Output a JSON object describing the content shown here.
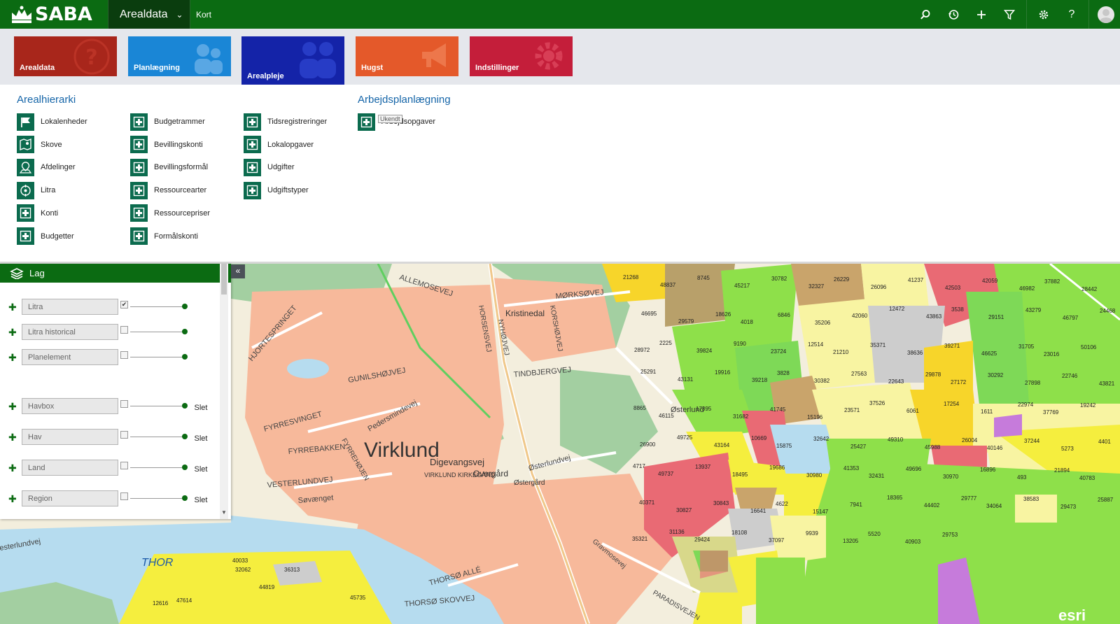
{
  "app": {
    "logo_text": "SABA",
    "module": "Arealdata",
    "breadcrumb": "Kort"
  },
  "toolbar": {
    "icons": [
      "search-icon",
      "history-icon",
      "add-icon",
      "filter-icon",
      "settings-icon",
      "help-icon",
      "user-avatar"
    ]
  },
  "tiles": [
    {
      "label": "Arealdata",
      "color": "#a8261b",
      "icon": "question-icon"
    },
    {
      "label": "Planlægning",
      "color": "#1a86d6",
      "icon": "people-icon"
    },
    {
      "label": "Arealpleje",
      "color": "#1423a8",
      "icon": "people-icon"
    },
    {
      "label": "Hugst",
      "color": "#e4592a",
      "icon": "megaphone-icon"
    },
    {
      "label": "Indstillinger",
      "color": "#c41e3a",
      "icon": "gear-icon"
    }
  ],
  "menu": {
    "arealhierarki_title": "Arealhierarki",
    "arbejdsplan_title": "Arbejdsplanlægning",
    "col1": [
      "Lokalenheder",
      "Skove",
      "Afdelinger",
      "Litra",
      "Konti",
      "Budgetter"
    ],
    "col2": [
      "Budgetrammer",
      "Bevillingskonti",
      "Bevillingsformål",
      "Ressourcearter",
      "Ressourcepriser",
      "Formålskonti"
    ],
    "col3": [
      "Tidsregistreringer",
      "Lokalopgaver",
      "Udgifter",
      "Udgiftstyper"
    ],
    "col4": [
      "Arbejdsopgaver"
    ],
    "tooltip": "Ukendt"
  },
  "layers": {
    "title": "Lag",
    "delete_label": "Slet",
    "items": [
      {
        "name": "Litra",
        "checked": true,
        "deletable": false
      },
      {
        "name": "Litra historical",
        "checked": false,
        "deletable": false
      },
      {
        "name": "Planelement",
        "checked": false,
        "deletable": false
      },
      {
        "name": "Havbox",
        "checked": false,
        "deletable": true
      },
      {
        "name": "Hav",
        "checked": false,
        "deletable": true
      },
      {
        "name": "Land",
        "checked": false,
        "deletable": true
      },
      {
        "name": "Region",
        "checked": false,
        "deletable": true
      }
    ]
  },
  "map": {
    "town_label": "Virklund",
    "place_labels": [
      "Kristinedal",
      "Østerlund",
      "Østergård",
      "Overgård",
      "VIRKLUND KIRKEGÅRD",
      "THOR",
      "Digevangsvej"
    ],
    "road_labels": [
      "ALLEMOSEVEJ",
      "MØRKSØVEJ",
      "HORSENSVEJ",
      "NYHØJVEJ",
      "KORSHØJVEJ",
      "TINDBJERGVEJ",
      "HJORTESPRINGET",
      "GUNILSHØJVEJ",
      "Pedersmindevej",
      "FYRRESVINGET",
      "FYRREBAKKEN",
      "FYRREHØJEN",
      "VESTERLUNDVEJ",
      "Søvænget",
      "Østerlundvej",
      "Gravmosevej",
      "THORSØ ALLÉ",
      "THORSØ SKOVVEJ",
      "PARADISVEJEN",
      "esterlundvej"
    ],
    "parcel_labels": [
      "21268",
      "48837",
      "8745",
      "45217",
      "30782",
      "32327",
      "26229",
      "26096",
      "41237",
      "42503",
      "42059",
      "46982",
      "37882",
      "28442",
      "46695",
      "29579",
      "18626",
      "4018",
      "6846",
      "35206",
      "42060",
      "12472",
      "43863",
      "3538",
      "29151",
      "43279",
      "46797",
      "24468",
      "28972",
      "2225",
      "39824",
      "9190",
      "23724",
      "12514",
      "21210",
      "35371",
      "38636",
      "39271",
      "46625",
      "31705",
      "23016",
      "50106",
      "25291",
      "43131",
      "19916",
      "39218",
      "3828",
      "30382",
      "27563",
      "22643",
      "29878",
      "27172",
      "30292",
      "27898",
      "22746",
      "43821",
      "8865",
      "46115",
      "17395",
      "31682",
      "41745",
      "15196",
      "23571",
      "37526",
      "6061",
      "17254",
      "1611",
      "22974",
      "37769",
      "19242",
      "26900",
      "49725",
      "43164",
      "10669",
      "15875",
      "32642",
      "25427",
      "49310",
      "45988",
      "26004",
      "40146",
      "37244",
      "5273",
      "4401",
      "4717",
      "49737",
      "13937",
      "18495",
      "19686",
      "30980",
      "41353",
      "32431",
      "49696",
      "30970",
      "16896",
      "493",
      "21894",
      "40783",
      "40371",
      "30827",
      "30843",
      "16641",
      "4622",
      "15147",
      "7941",
      "18365",
      "44402",
      "29777",
      "34064",
      "38583",
      "29473",
      "25887",
      "35321",
      "31136",
      "29424",
      "18108",
      "37097",
      "9939",
      "13205",
      "5520",
      "40903",
      "29753",
      "40033",
      "32062",
      "36313",
      "44819",
      "45735",
      "12616",
      "47614"
    ]
  }
}
